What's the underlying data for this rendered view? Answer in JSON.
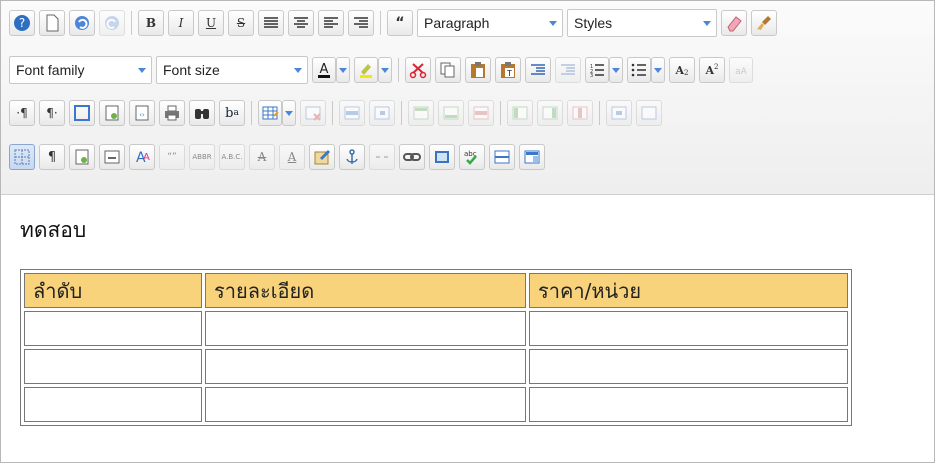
{
  "toolbar": {
    "format_dropdown": "Paragraph",
    "styles_dropdown": "Styles",
    "font_family_dropdown": "Font family",
    "font_size_dropdown": "Font size"
  },
  "content": {
    "paragraph": "ทดสอบ",
    "table": {
      "headers": [
        "ลำดับ",
        "รายละเอียด",
        "ราคา/หน่วย"
      ],
      "rows": [
        [
          "",
          "",
          ""
        ],
        [
          "",
          "",
          ""
        ],
        [
          "",
          "",
          ""
        ]
      ]
    }
  },
  "colors": {
    "header_fill": "#f8d37b",
    "accent": "#4d86d6"
  }
}
